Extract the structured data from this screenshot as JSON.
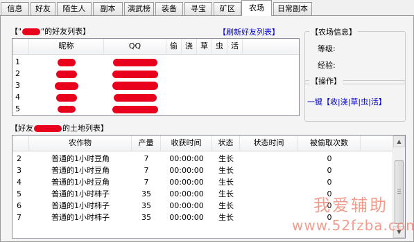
{
  "tabs": [
    {
      "label": "信息",
      "active": false
    },
    {
      "label": "好友",
      "active": false
    },
    {
      "label": "陌生人",
      "active": false
    },
    {
      "label": "副本",
      "active": false
    },
    {
      "label": "演武榜",
      "active": false
    },
    {
      "label": "装备",
      "active": false
    },
    {
      "label": "寻宝",
      "active": false
    },
    {
      "label": "矿区",
      "active": false
    },
    {
      "label": "农场",
      "active": true
    },
    {
      "label": "日常副本",
      "active": false
    }
  ],
  "friends": {
    "title_prefix": "【\"",
    "title_suffix": "\"的好友列表】",
    "refresh_label": "【刷新好友列表】",
    "columns": [
      "昵称",
      "QQ",
      "偷",
      "浇",
      "草",
      "虫",
      "活"
    ],
    "rows": [
      {
        "index": "1"
      },
      {
        "index": "2"
      },
      {
        "index": "3"
      },
      {
        "index": "4"
      },
      {
        "index": "5"
      }
    ]
  },
  "farm_info": {
    "title": "【农场信息】",
    "level_label": "等级:",
    "exp_label": "经验:"
  },
  "operations": {
    "title": "【操作】",
    "one_click_label": "一键【收|浇|草|虫|活】"
  },
  "land": {
    "title_prefix": "【好友",
    "title_suffix": "的土地列表】",
    "columns": [
      "农作物",
      "产量",
      "收获时间",
      "状态",
      "状态时间",
      "被偷取次数"
    ],
    "rows": [
      {
        "index": "2",
        "crop": "普通的1小时豆角",
        "yield": "7",
        "harvest_time": "00:00:00",
        "status": "生长",
        "status_time": "",
        "stolen": "0"
      },
      {
        "index": "3",
        "crop": "普通的1小时豆角",
        "yield": "7",
        "harvest_time": "00:00:00",
        "status": "生长",
        "status_time": "",
        "stolen": "0"
      },
      {
        "index": "4",
        "crop": "普通的1小时豆角",
        "yield": "7",
        "harvest_time": "00:00:00",
        "status": "生长",
        "status_time": "",
        "stolen": "0"
      },
      {
        "index": "5",
        "crop": "普通的1小时柿子",
        "yield": "35",
        "harvest_time": "00:00:00",
        "status": "生长",
        "status_time": "",
        "stolen": "0"
      },
      {
        "index": "6",
        "crop": "普通的1小时柿子",
        "yield": "35",
        "harvest_time": "00:00:00",
        "status": "生长",
        "status_time": "",
        "stolen": "0"
      },
      {
        "index": "7",
        "crop": "普通的1小时柿子",
        "yield": "35",
        "harvest_time": "00:00:00",
        "status": "生长",
        "status_time": "",
        "stolen": "0"
      }
    ]
  },
  "watermark": {
    "line1": "我爱辅助",
    "line2": "www.52fzba.com"
  },
  "colors": {
    "accent_link": "#0000cc",
    "redaction": "#e8001c",
    "watermark": "#ee8d7a"
  }
}
